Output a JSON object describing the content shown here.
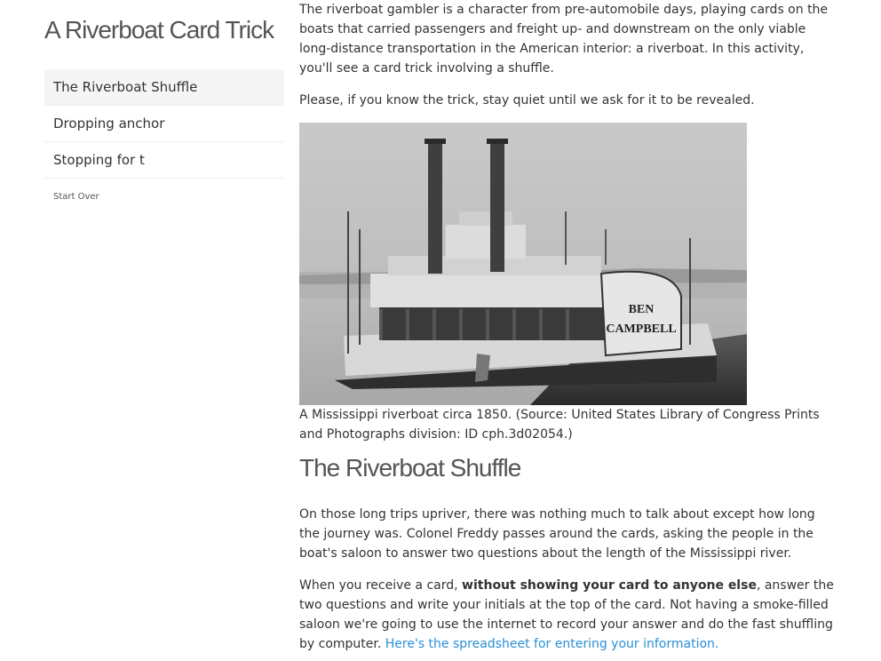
{
  "sidebar": {
    "title": "A Riverboat Card Trick",
    "nav_items": [
      {
        "label": "The Riverboat Shuffle",
        "active": true
      },
      {
        "label": "Dropping anchor",
        "active": false
      },
      {
        "label": "Stopping for t",
        "active": false
      }
    ],
    "start_over": "Start Over"
  },
  "main": {
    "intro": "The riverboat gambler is a character from pre-automobile days, playing cards on the boats that carried passengers and freight up- and downstream on the only viable long-distance transportation in the American interior: a riverboat. In this activity, you'll see a card trick involving a shuffle.",
    "quiet_notice": "Please, if you know the trick, stay quiet until we ask for it to be revealed.",
    "photo": {
      "paddle_box_text_line1": "BEN",
      "paddle_box_text_line2": "CAMPBELL",
      "caption": "A Mississippi riverboat circa 1850. (Source: United States Library of Congress Prints and Photographs division: ID cph.3d02054.)"
    },
    "section_title": "The Riverboat Shuffle",
    "para_trip": "On those long trips upriver, there was nothing much to talk about except how long the journey was. Colonel Freddy passes around the cards, asking the people in the boat's saloon to answer two questions about the length of the Mississippi river.",
    "para_card": {
      "before": "When you receive a card, ",
      "bold": "without showing your card to anyone else",
      "after": ", answer the two questions and write your initials at the top of the card. Not having a smoke-filled saloon we're going to use the internet to record your answer and do the fast shuffling by computer. ",
      "link": "Here's the spreadsheet for entering your information."
    }
  }
}
